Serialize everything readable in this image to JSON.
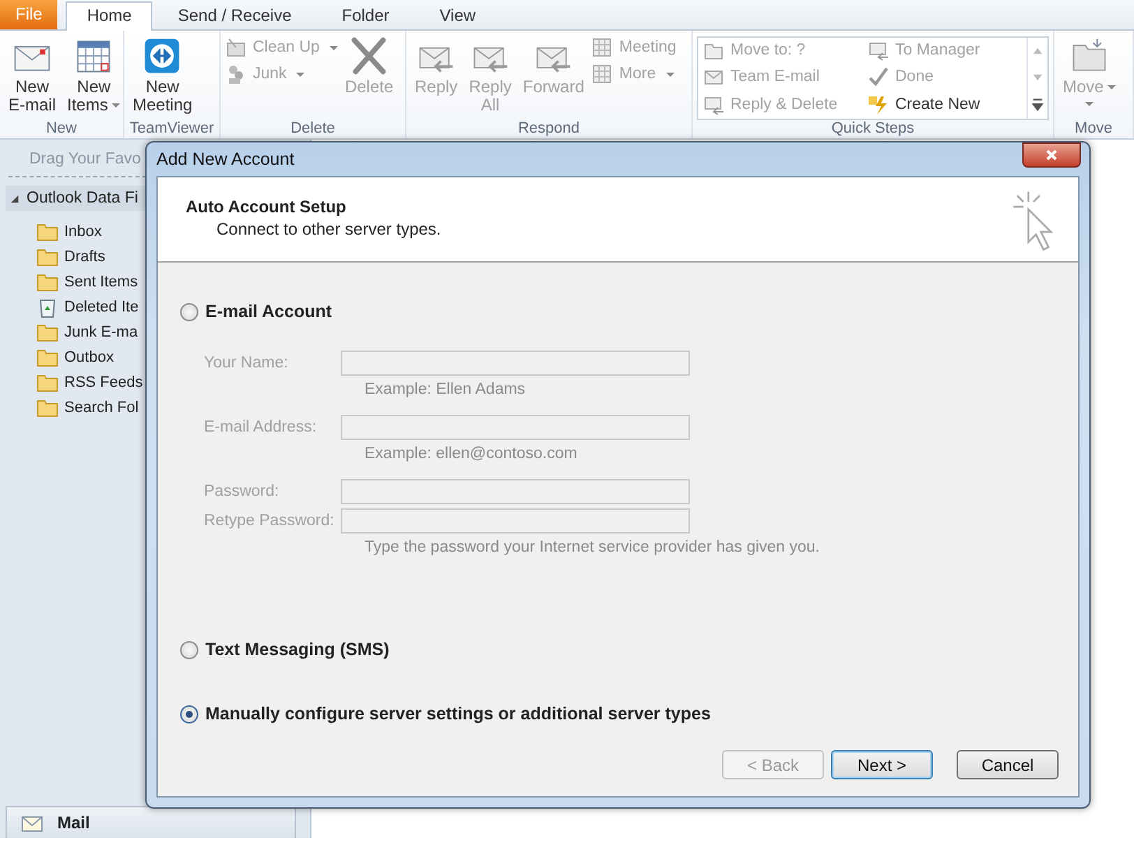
{
  "tabs": [
    {
      "label": "File",
      "kind": "file",
      "selected": false
    },
    {
      "label": "Home",
      "kind": "tab",
      "selected": true
    },
    {
      "label": "Send / Receive",
      "kind": "tab",
      "selected": false
    },
    {
      "label": "Folder",
      "kind": "tab",
      "selected": false
    },
    {
      "label": "View",
      "kind": "tab",
      "selected": false
    }
  ],
  "ribbon": {
    "groups": [
      {
        "label": "New",
        "kind": "buttons",
        "items": [
          {
            "lines": [
              "New",
              "E-mail"
            ],
            "kind": "large",
            "dropdown": false,
            "disabled": false
          },
          {
            "lines": [
              "New",
              "Items"
            ],
            "kind": "large",
            "dropdown": true,
            "disabled": false
          }
        ]
      },
      {
        "label": "TeamViewer",
        "kind": "buttons",
        "items": [
          {
            "lines": [
              "New",
              "Meeting"
            ],
            "kind": "large",
            "dropdown": false,
            "disabled": false
          }
        ]
      },
      {
        "label": "Delete",
        "kind": "buttons",
        "items": [
          {
            "lines": [
              "Clean Up"
            ],
            "kind": "small",
            "dropdown": true,
            "disabled": true
          },
          {
            "lines": [
              "Junk"
            ],
            "kind": "small",
            "dropdown": true,
            "disabled": true
          },
          {
            "lines": [
              "Delete"
            ],
            "kind": "large",
            "dropdown": false,
            "disabled": true
          }
        ]
      },
      {
        "label": "Respond",
        "kind": "buttons",
        "items": [
          {
            "lines": [
              "Reply"
            ],
            "kind": "large",
            "dropdown": false,
            "disabled": true
          },
          {
            "lines": [
              "Reply",
              "All"
            ],
            "kind": "large",
            "dropdown": false,
            "disabled": true
          },
          {
            "lines": [
              "Forward"
            ],
            "kind": "large",
            "dropdown": false,
            "disabled": true
          },
          {
            "lines": [
              "Meeting"
            ],
            "kind": "small",
            "dropdown": false,
            "disabled": true
          },
          {
            "lines": [
              "More"
            ],
            "kind": "small",
            "dropdown": true,
            "disabled": true
          }
        ]
      },
      {
        "label": "Quick Steps",
        "kind": "gallery",
        "items": [
          {
            "lines": [
              "Move to: ?"
            ],
            "disabled": true
          },
          {
            "lines": [
              "To Manager"
            ],
            "disabled": true
          },
          {
            "lines": [
              "Team E-mail"
            ],
            "disabled": true
          },
          {
            "lines": [
              "Done"
            ],
            "disabled": true
          },
          {
            "lines": [
              "Reply & Delete"
            ],
            "disabled": true
          },
          {
            "lines": [
              "Create New"
            ],
            "disabled": false
          }
        ]
      },
      {
        "label": "Move",
        "kind": "buttons",
        "items": [
          {
            "lines": [
              "Move"
            ],
            "kind": "large",
            "dropdown": true,
            "disabled": true
          }
        ]
      }
    ]
  },
  "nav": {
    "favorites_hint": "Drag Your Favo",
    "tree": {
      "label": "Outlook Data Fi",
      "expanded": true,
      "children": [
        {
          "label": "Inbox",
          "kind": "folder"
        },
        {
          "label": "Drafts",
          "kind": "folder"
        },
        {
          "label": "Sent Items",
          "kind": "folder"
        },
        {
          "label": "Deleted Ite",
          "kind": "trash"
        },
        {
          "label": "Junk E-ma",
          "kind": "folder"
        },
        {
          "label": "Outbox",
          "kind": "folder"
        },
        {
          "label": "RSS Feeds",
          "kind": "folder"
        },
        {
          "label": "Search Fol",
          "kind": "folder"
        }
      ]
    },
    "mail_button": "Mail"
  },
  "dialog": {
    "title": "Add New Account",
    "heading": "Auto Account Setup",
    "subheading": "Connect to other server types.",
    "options": [
      {
        "label": "E-mail Account",
        "selected": false,
        "fields": [
          {
            "label": "Your Name:",
            "disabled": true,
            "note": "Example: Ellen Adams"
          },
          {
            "label": "E-mail Address:",
            "disabled": true,
            "note": "Example: ellen@contoso.com"
          },
          {
            "label": "Password:",
            "disabled": true
          },
          {
            "label": "Retype Password:",
            "disabled": true,
            "note": "Type the password your Internet service provider has given you."
          }
        ]
      },
      {
        "label": "Text Messaging (SMS)",
        "selected": false
      },
      {
        "label": "Manually configure server settings or additional server types",
        "selected": true
      }
    ],
    "buttons": [
      {
        "label": "< Back",
        "disabled": true,
        "default": false
      },
      {
        "label": "Next >",
        "disabled": false,
        "default": true
      },
      {
        "label": "Cancel",
        "disabled": false,
        "default": false
      }
    ]
  }
}
